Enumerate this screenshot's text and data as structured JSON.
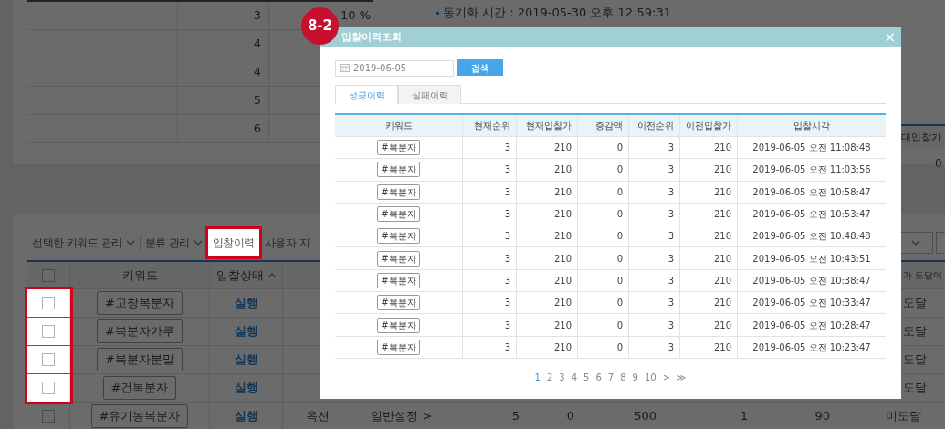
{
  "ranking_table": {
    "rows": [
      {
        "count": "3",
        "share": "10 %"
      },
      {
        "count": "4"
      },
      {
        "count": "4"
      },
      {
        "count": "5"
      },
      {
        "count": "6"
      }
    ]
  },
  "sync_info": "동기화 시간 : 2019-05-30 오후 12:59:31",
  "summary": {
    "header": "대입찰가",
    "value": "0"
  },
  "toolbar": {
    "items": [
      {
        "kind": "dropdown",
        "label": "선택한 키워드 관리",
        "highlighted": false
      },
      {
        "kind": "dropdown",
        "label": "분류 관리",
        "highlighted": false
      },
      {
        "kind": "button",
        "label": "입찰이력",
        "highlighted": true
      },
      {
        "kind": "button",
        "label": "사용자 지",
        "highlighted": false
      }
    ]
  },
  "keyword_table": {
    "header_checked": false,
    "columns": [
      {
        "label": "키워드",
        "sorted": false
      },
      {
        "label": "입찰상태",
        "sorted": true
      }
    ],
    "reach_header": "가 도달여",
    "rows": [
      {
        "checked": false,
        "highlighted": true,
        "keyword": "#고창복분자",
        "status": "실행",
        "reach": "도달"
      },
      {
        "checked": false,
        "highlighted": true,
        "keyword": "#복분자가루",
        "status": "실행",
        "reach": "도달"
      },
      {
        "checked": false,
        "highlighted": true,
        "keyword": "#복분자분말",
        "status": "실행",
        "reach": "도달"
      },
      {
        "checked": false,
        "highlighted": true,
        "keyword": "#건복분자",
        "status": "실행",
        "reach": "도달"
      },
      {
        "checked": false,
        "highlighted": false,
        "keyword": "#유기농복분자",
        "status": "실행",
        "cells": [
          "옥션",
          "일반설정 >",
          "5",
          "0",
          "500",
          "1",
          "90"
        ],
        "reach": "미도달"
      }
    ]
  },
  "modal": {
    "badge": "8-2",
    "title": "입찰이력조회",
    "close": "×",
    "date_value": "2019-06-05",
    "search_button": "검색",
    "tabs": [
      {
        "label": "성공이력",
        "selected": true
      },
      {
        "label": "실패이력",
        "selected": false
      }
    ],
    "columns": [
      "키워드",
      "현재순위",
      "현재입찰가",
      "증감액",
      "이전순위",
      "이전입찰가",
      "입찰시각"
    ],
    "rows": [
      {
        "keyword": "#복분자",
        "rank": "3",
        "bid": "210",
        "change": "0",
        "prev_rank": "3",
        "prev_bid": "210",
        "time": "2019-06-05 오전 11:08:48"
      },
      {
        "keyword": "#복분자",
        "rank": "3",
        "bid": "210",
        "change": "0",
        "prev_rank": "3",
        "prev_bid": "210",
        "time": "2019-06-05 오전 11:03:56"
      },
      {
        "keyword": "#복분자",
        "rank": "3",
        "bid": "210",
        "change": "0",
        "prev_rank": "3",
        "prev_bid": "210",
        "time": "2019-06-05 오전 10:58:47"
      },
      {
        "keyword": "#복분자",
        "rank": "3",
        "bid": "210",
        "change": "0",
        "prev_rank": "3",
        "prev_bid": "210",
        "time": "2019-06-05 오전 10:53:47"
      },
      {
        "keyword": "#복분자",
        "rank": "3",
        "bid": "210",
        "change": "0",
        "prev_rank": "3",
        "prev_bid": "210",
        "time": "2019-06-05 오전 10:48:48"
      },
      {
        "keyword": "#복분자",
        "rank": "3",
        "bid": "210",
        "change": "0",
        "prev_rank": "3",
        "prev_bid": "210",
        "time": "2019-06-05 오전 10:43:51"
      },
      {
        "keyword": "#복분자",
        "rank": "3",
        "bid": "210",
        "change": "0",
        "prev_rank": "3",
        "prev_bid": "210",
        "time": "2019-06-05 오전 10:38:47"
      },
      {
        "keyword": "#복분자",
        "rank": "3",
        "bid": "210",
        "change": "0",
        "prev_rank": "3",
        "prev_bid": "210",
        "time": "2019-06-05 오전 10:33:47"
      },
      {
        "keyword": "#복분자",
        "rank": "3",
        "bid": "210",
        "change": "0",
        "prev_rank": "3",
        "prev_bid": "210",
        "time": "2019-06-05 오전 10:28:47"
      },
      {
        "keyword": "#복분자",
        "rank": "3",
        "bid": "210",
        "change": "0",
        "prev_rank": "3",
        "prev_bid": "210",
        "time": "2019-06-05 오전 10:23:47"
      }
    ],
    "pagination": {
      "pages": [
        {
          "label": "1",
          "selected": true
        },
        {
          "label": "2",
          "selected": false
        },
        {
          "label": "3",
          "selected": false
        },
        {
          "label": "4",
          "selected": false
        },
        {
          "label": "5",
          "selected": false
        },
        {
          "label": "6",
          "selected": false
        },
        {
          "label": "7",
          "selected": false
        },
        {
          "label": "8",
          "selected": false
        },
        {
          "label": "9",
          "selected": false
        },
        {
          "label": "10",
          "selected": false
        }
      ],
      "next": ">",
      "last": "≫"
    }
  }
}
